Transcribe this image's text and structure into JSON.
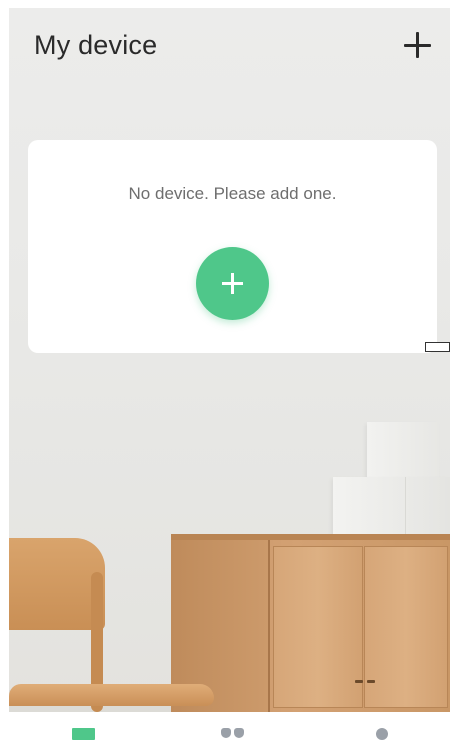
{
  "header": {
    "title": "My device",
    "add_icon": "plus-icon"
  },
  "device_list": {
    "empty_message": "No device. Please add one.",
    "add_button_icon": "plus-icon"
  },
  "tabs": [
    {
      "icon": "device-tab-icon",
      "active": true,
      "color": "#4fc78a"
    },
    {
      "icon": "scenes-tab-icon",
      "active": false,
      "color": "#9aa0a8"
    },
    {
      "icon": "profile-tab-icon",
      "active": false,
      "color": "#9aa0a8"
    }
  ],
  "colors": {
    "accent": "#4fc78a",
    "title_text": "#2a2a2a",
    "muted_text": "#6e6e6e",
    "inactive_icon": "#9aa0a8"
  }
}
